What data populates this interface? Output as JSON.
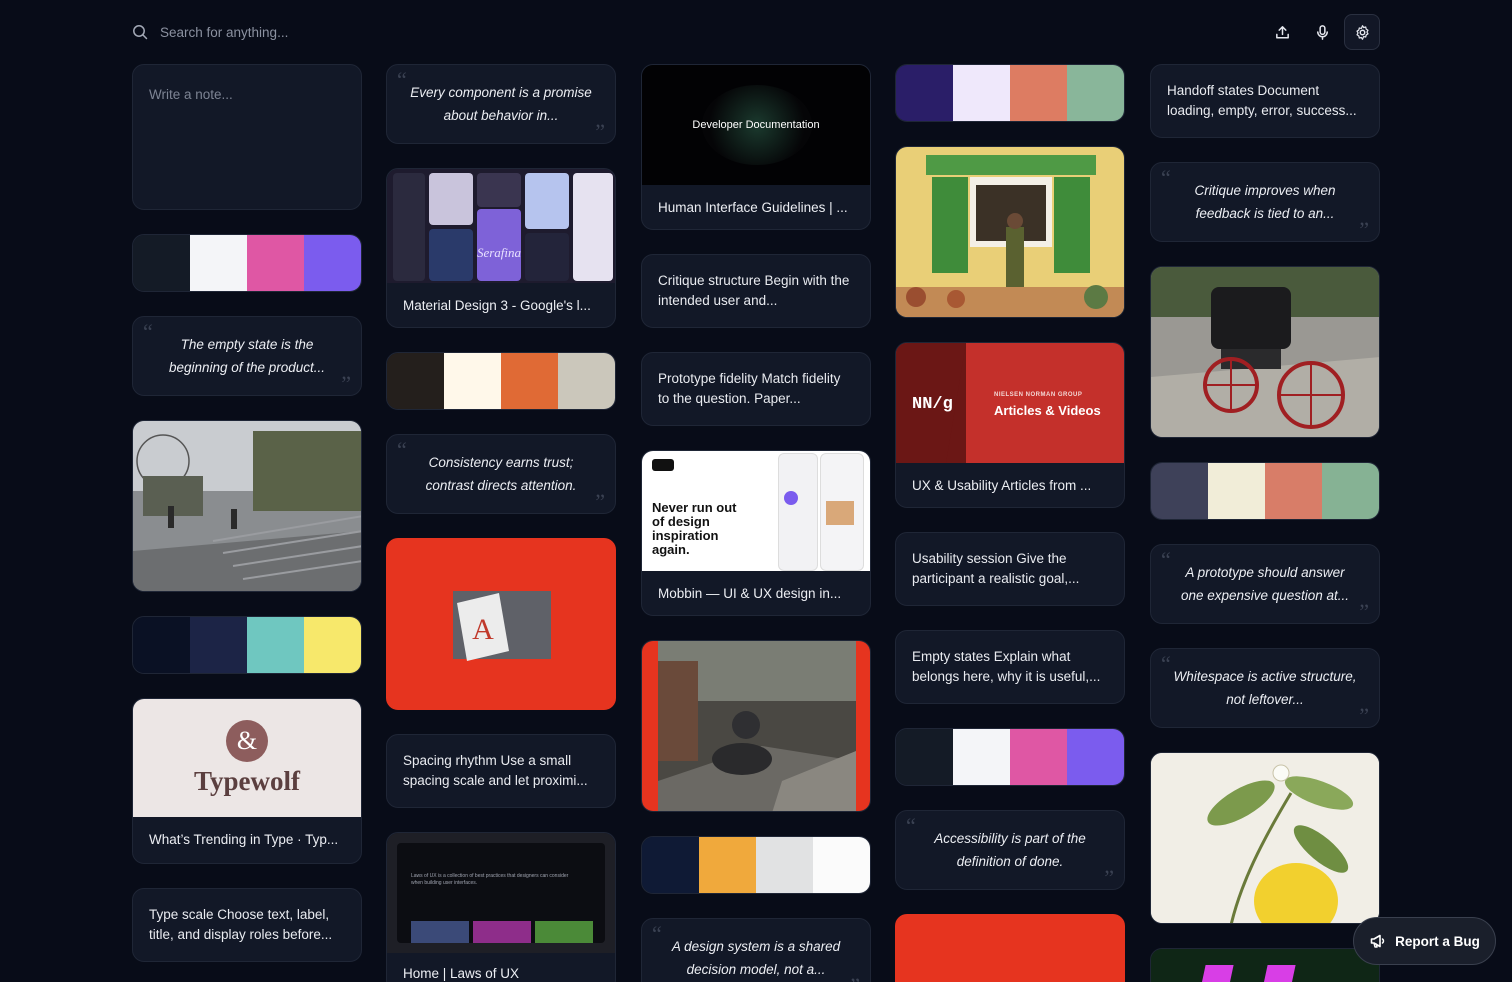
{
  "search": {
    "placeholder": "Search for anything..."
  },
  "toolbar": {
    "upload_icon": "upload-icon",
    "mic_icon": "microphone-icon",
    "settings_icon": "gear-icon"
  },
  "notes": {
    "new_note_placeholder": "Write a note..."
  },
  "quotes": {
    "component_promise": "Every component is a promise about behavior in...",
    "empty_state": "The empty state is the beginning of the product...",
    "consistency": "Consistency earns trust; contrast directs attention.",
    "critique": "Critique improves when feedback is tied to an...",
    "prototype": "A prototype should answer one expensive question at...",
    "whitespace": "Whitespace is active structure, not leftover...",
    "accessibility": "Accessibility is part of the definition of done.",
    "design_system": "A design system is a shared decision model, not a..."
  },
  "text_notes": {
    "handoff": "Handoff states Document loading, empty, error, success...",
    "critique_structure": "Critique structure Begin with the intended user and...",
    "prototype_fidelity": "Prototype fidelity Match fidelity to the question. Paper...",
    "spacing_rhythm": "Spacing rhythm Use a small spacing scale and let proximi...",
    "usability_session": "Usability session Give the participant a realistic goal,...",
    "empty_states": "Empty states Explain what belongs here, why it is useful,...",
    "type_scale": "Type scale Choose text, label, title, and display roles before..."
  },
  "links": {
    "hig": {
      "title": "Human Interface Guidelines | ...",
      "thumb_text": "Developer Documentation"
    },
    "material": {
      "title": "Material Design 3 - Google's l..."
    },
    "nng": {
      "title": "UX & Usability Articles from ...",
      "logo": "NN/g",
      "brand_small": "NIELSEN NORMAN GROUP",
      "brand_big": "Articles & Videos"
    },
    "mobbin": {
      "title": "Mobbin — UI & UX design in...",
      "headline": "Never run out of design inspiration again."
    },
    "typewolf": {
      "title": "What’s Trending in Type · Typ...",
      "logo": "Typewolf"
    },
    "lawsux": {
      "title": "Home | Laws of UX",
      "thumb_text": "Laws of UX is a collection of best practices that designers can consider when building user interfaces."
    }
  },
  "palettes": {
    "p1": [
      "#141b26",
      "#f4f5f8",
      "#df57a4",
      "#7b5cee"
    ],
    "p2": [
      "#241f1c",
      "#fff8ea",
      "#e06a35",
      "#cbc7bb"
    ],
    "p3": [
      "#0a1124",
      "#1c2446",
      "#6fc7c0",
      "#f7e86b"
    ],
    "p4": [
      "#2a1e68",
      "#efe8fb",
      "#dd7c62",
      "#89b69a"
    ],
    "p5": [
      "#3e4159",
      "#f1edd8",
      "#d87d68",
      "#86b294"
    ],
    "p6": [
      "#141b26",
      "#f4f5f8",
      "#df57a4",
      "#7b5cee"
    ],
    "p7": [
      "#0f1a35",
      "#f0a93c",
      "#e1e2e3",
      "#fbfbfb"
    ]
  },
  "report": {
    "label": "Report a Bug"
  }
}
